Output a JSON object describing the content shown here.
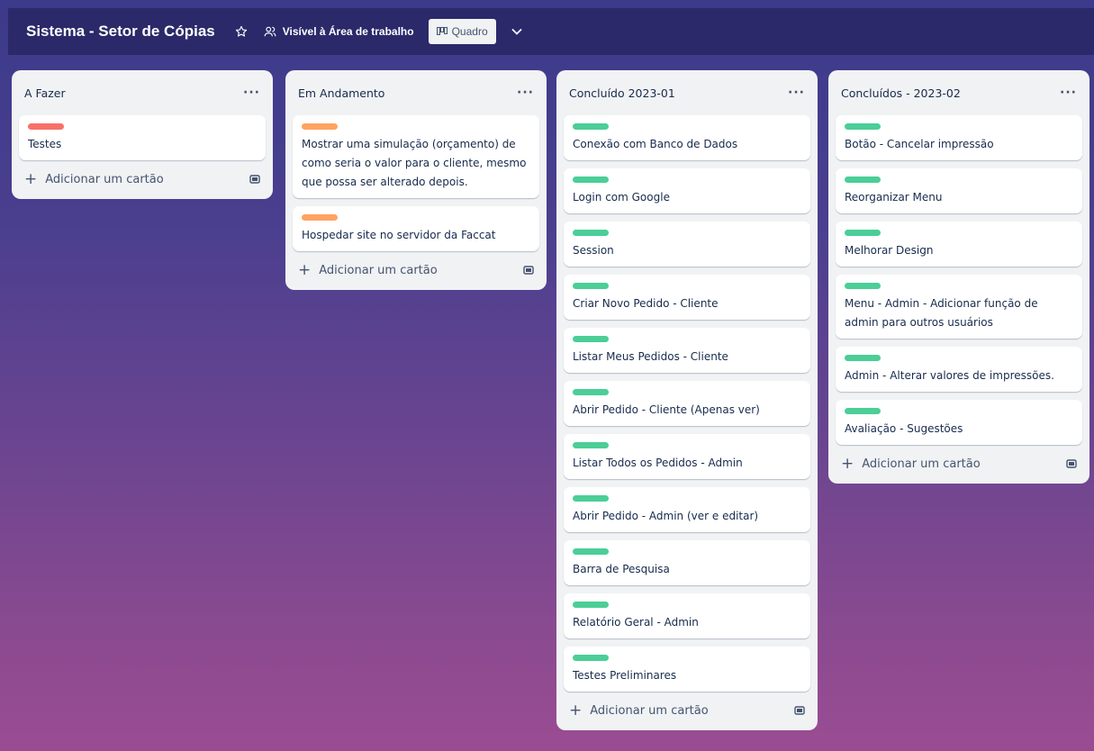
{
  "board": {
    "title": "Sistema - Setor de Cópias",
    "visibility": "Visível à Área de trabalho",
    "view": "Quadro"
  },
  "colors": {
    "red": "#f87168",
    "orange": "#fea362",
    "green": "#4bce97"
  },
  "add_card_label": "Adicionar um cartão",
  "lists": [
    {
      "title": "A Fazer",
      "cards": [
        {
          "title": "Testes",
          "label": "red"
        }
      ]
    },
    {
      "title": "Em Andamento",
      "cards": [
        {
          "title": "Mostrar uma simulação (orçamento) de como seria o valor para o cliente, mesmo que possa ser alterado depois.",
          "label": "orange"
        },
        {
          "title": "Hospedar site no servidor da Faccat",
          "label": "orange"
        }
      ]
    },
    {
      "title": "Concluído 2023-01",
      "cards": [
        {
          "title": "Conexão com Banco de Dados",
          "label": "green"
        },
        {
          "title": "Login com Google",
          "label": "green"
        },
        {
          "title": "Session",
          "label": "green"
        },
        {
          "title": "Criar Novo Pedido - Cliente",
          "label": "green"
        },
        {
          "title": "Listar Meus Pedidos - Cliente",
          "label": "green"
        },
        {
          "title": "Abrir Pedido - Cliente (Apenas ver)",
          "label": "green"
        },
        {
          "title": "Listar Todos os Pedidos - Admin",
          "label": "green"
        },
        {
          "title": "Abrir Pedido - Admin (ver e editar)",
          "label": "green"
        },
        {
          "title": "Barra de Pesquisa",
          "label": "green"
        },
        {
          "title": "Relatório Geral - Admin",
          "label": "green"
        },
        {
          "title": "Testes Preliminares",
          "label": "green"
        }
      ]
    },
    {
      "title": "Concluídos - 2023-02",
      "cards": [
        {
          "title": "Botão - Cancelar impressão",
          "label": "green"
        },
        {
          "title": "Reorganizar Menu",
          "label": "green"
        },
        {
          "title": "Melhorar Design",
          "label": "green"
        },
        {
          "title": "Menu - Admin - Adicionar função de admin para outros usuários",
          "label": "green"
        },
        {
          "title": "Admin - Alterar valores de impressões.",
          "label": "green"
        },
        {
          "title": "Avaliação - Sugestões",
          "label": "green"
        }
      ]
    }
  ]
}
